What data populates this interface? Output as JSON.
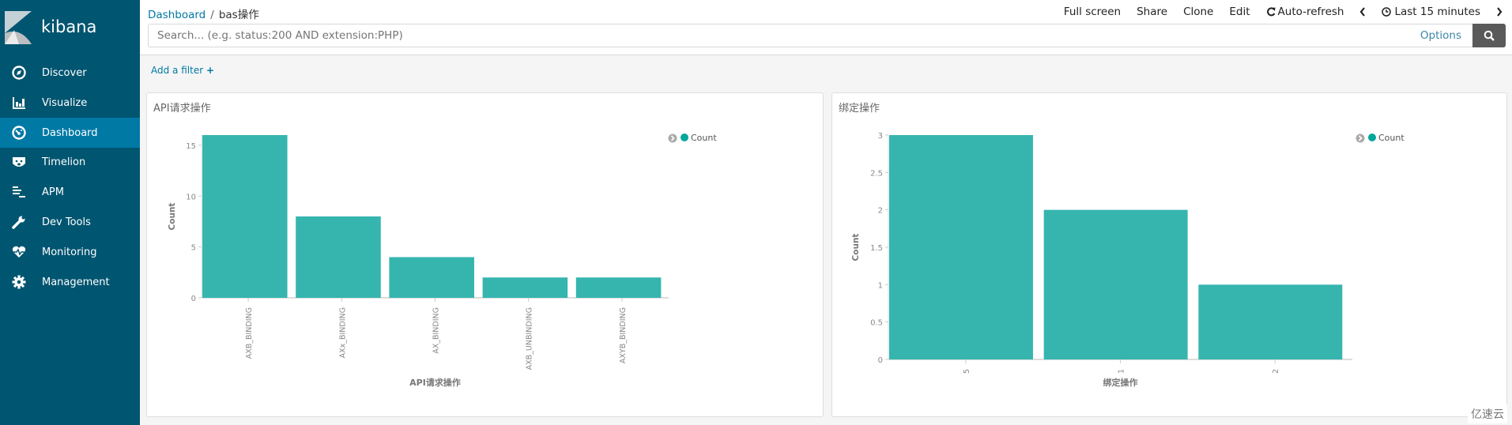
{
  "sidebar": {
    "logo_text": "kibana",
    "items": [
      {
        "label": "Discover",
        "icon": "compass-icon"
      },
      {
        "label": "Visualize",
        "icon": "bar-chart-icon"
      },
      {
        "label": "Dashboard",
        "icon": "dashboard-gauge-icon",
        "active": true
      },
      {
        "label": "Timelion",
        "icon": "bear-icon"
      },
      {
        "label": "APM",
        "icon": "apm-lines-icon"
      },
      {
        "label": "Dev Tools",
        "icon": "wrench-icon"
      },
      {
        "label": "Monitoring",
        "icon": "heartbeat-icon"
      },
      {
        "label": "Management",
        "icon": "gear-icon"
      }
    ]
  },
  "header": {
    "breadcrumb": [
      "Dashboard",
      "bas操作"
    ],
    "menu": {
      "full_screen": "Full screen",
      "share": "Share",
      "clone": "Clone",
      "edit": "Edit",
      "auto_refresh": "Auto-refresh",
      "time_range": "Last 15 minutes"
    },
    "search": {
      "placeholder": "Search... (e.g. status:200 AND extension:PHP)",
      "value": "",
      "options": "Options"
    }
  },
  "filter": {
    "add_label": "Add a filter"
  },
  "colors": {
    "sidebar": "#005571",
    "active": "#0079a5",
    "bar": "#35b5ae"
  },
  "chart_data": [
    {
      "type": "bar",
      "title": "API请求操作",
      "xlabel": "API请求操作",
      "ylabel": "Count",
      "categories": [
        "AXB_BINDING",
        "AXx_BINDING",
        "AX_BINDING",
        "AXB_UNBINDING",
        "AXYB_BINDING"
      ],
      "values": [
        16,
        8,
        4,
        2,
        2
      ],
      "ylim": [
        0,
        16
      ],
      "yticks": [
        0,
        5,
        10,
        15
      ],
      "legend": {
        "name": "Count",
        "position": "top-right"
      },
      "grid": false
    },
    {
      "type": "bar",
      "title": "绑定操作",
      "xlabel": "绑定操作",
      "ylabel": "Count",
      "categories": [
        "5",
        "1",
        "2"
      ],
      "values": [
        3,
        2,
        1
      ],
      "ylim": [
        0,
        3
      ],
      "yticks": [
        0,
        0.5,
        1,
        1.5,
        2,
        2.5,
        3
      ],
      "legend": {
        "name": "Count",
        "position": "top-right"
      },
      "grid": false
    }
  ],
  "watermark": "亿速云"
}
